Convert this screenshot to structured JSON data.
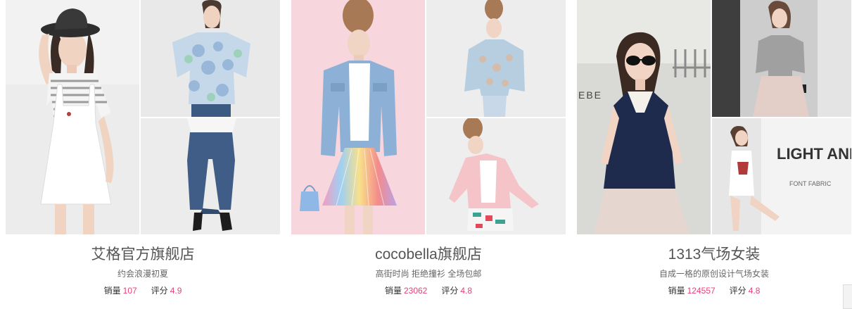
{
  "shops": [
    {
      "name": "艾格官方旗舰店",
      "tagline": "约会浪漫初夏",
      "sales_label": "销量",
      "sales": "107",
      "rating_label": "评分",
      "rating": "4.9"
    },
    {
      "name": "cocobella旗舰店",
      "tagline": "高街时尚 拒绝撞衫 全场包邮",
      "sales_label": "销量",
      "sales": "23062",
      "rating_label": "评分",
      "rating": "4.8"
    },
    {
      "name": "1313气场女装",
      "tagline": "自成一格的原创设计气场女装",
      "sales_label": "销量",
      "sales": "124557",
      "rating_label": "评分",
      "rating": "4.8"
    }
  ],
  "colors": {
    "accent_number": "#e4427a",
    "title_text": "#555555"
  },
  "image_text": {
    "shop3_photo_c_poster": "LIGHT AND BOLD",
    "shop3_photo_c_sub": "FONT FABRIC",
    "shop3_photo_a_sign": "EBE"
  }
}
